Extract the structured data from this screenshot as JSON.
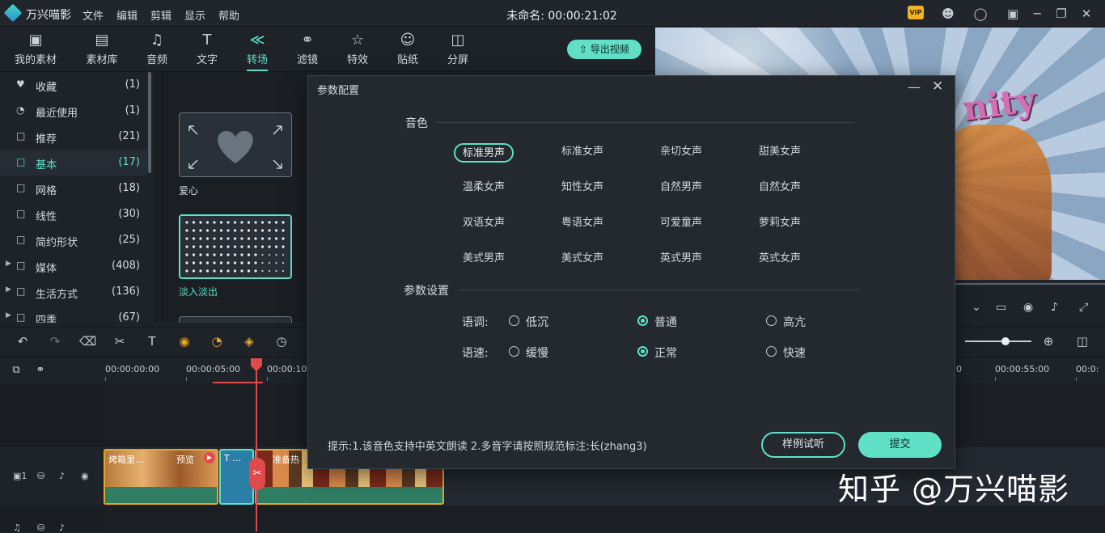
{
  "app": {
    "name": "万兴喵影",
    "project_title": "未命名: 00:00:21:02"
  },
  "menu": [
    "文件",
    "编辑",
    "剪辑",
    "显示",
    "帮助"
  ],
  "window_icons": {
    "vip": "VIP",
    "user": "user-icon",
    "chat": "message-icon",
    "store": "store-icon",
    "minimize": "─",
    "restore": "❐",
    "close": "✕"
  },
  "toolbar": {
    "tabs": [
      {
        "label": "我的素材",
        "icon": "folder-icon"
      },
      {
        "label": "素材库",
        "icon": "library-icon"
      },
      {
        "label": "音频",
        "icon": "music-icon"
      },
      {
        "label": "文字",
        "icon": "text-icon"
      },
      {
        "label": "转场",
        "icon": "transition-icon",
        "active": true
      },
      {
        "label": "滤镜",
        "icon": "filter-icon"
      },
      {
        "label": "特效",
        "icon": "effects-icon"
      },
      {
        "label": "贴纸",
        "icon": "sticker-icon"
      },
      {
        "label": "分屏",
        "icon": "split-screen-icon"
      }
    ],
    "export_label": "导出视频"
  },
  "categories": [
    {
      "label": "收藏",
      "count": "(1)",
      "icon": "heart-icon"
    },
    {
      "label": "最近使用",
      "count": "(1)",
      "icon": "clock-icon"
    },
    {
      "label": "推荐",
      "count": "(21)",
      "icon": "folder-icon"
    },
    {
      "label": "基本",
      "count": "(17)",
      "icon": "folder-icon",
      "active": true
    },
    {
      "label": "网格",
      "count": "(18)",
      "icon": "folder-icon"
    },
    {
      "label": "线性",
      "count": "(30)",
      "icon": "folder-icon"
    },
    {
      "label": "简约形状",
      "count": "(25)",
      "icon": "folder-icon"
    },
    {
      "label": "媒体",
      "count": "(408)",
      "icon": "folder-icon",
      "expandable": true
    },
    {
      "label": "生活方式",
      "count": "(136)",
      "icon": "folder-icon",
      "expandable": true
    },
    {
      "label": "四季",
      "count": "(67)",
      "icon": "folder-icon",
      "expandable": true
    }
  ],
  "transitions": [
    {
      "label": "爱心"
    },
    {
      "label": "淡入淡出",
      "selected": true
    }
  ],
  "timeline": {
    "ruler": [
      "00:00:00:00",
      "00:00:05:00",
      "00:00:10:0",
      "0",
      "00:00:55:00",
      "00:0:"
    ],
    "clips": [
      {
        "title": "烤箱里…",
        "badge": "预览"
      },
      {
        "title": "T …"
      },
      {
        "title": "准备热"
      }
    ],
    "track_label": "1"
  },
  "dialog": {
    "title": "参数配置",
    "voice_section": "音色",
    "voices": [
      [
        "标准男声",
        "标准女声",
        "亲切女声",
        "甜美女声"
      ],
      [
        "温柔女声",
        "知性女声",
        "自然男声",
        "自然女声"
      ],
      [
        "双语女声",
        "粤语女声",
        "可爱童声",
        "萝莉女声"
      ],
      [
        "美式男声",
        "美式女声",
        "英式男声",
        "英式女声"
      ]
    ],
    "selected_voice": "标准男声",
    "param_section": "参数设置",
    "pitch_label": "语调:",
    "pitch_options": [
      "低沉",
      "普通",
      "高亢"
    ],
    "pitch_selected": "普通",
    "speed_label": "语速:",
    "speed_options": [
      "缓慢",
      "正常",
      "快速"
    ],
    "speed_selected": "正常",
    "hint": "提示:1.该音色支持中英文朗读 2.多音字请按照规范标注:长(zhang3)",
    "sample_button": "样例试听",
    "submit_button": "提交"
  },
  "watermark": "知乎 @万兴喵影",
  "colors": {
    "accent": "#5fe0c7",
    "warning": "#e2a72a",
    "playhead": "#e04a4a"
  }
}
